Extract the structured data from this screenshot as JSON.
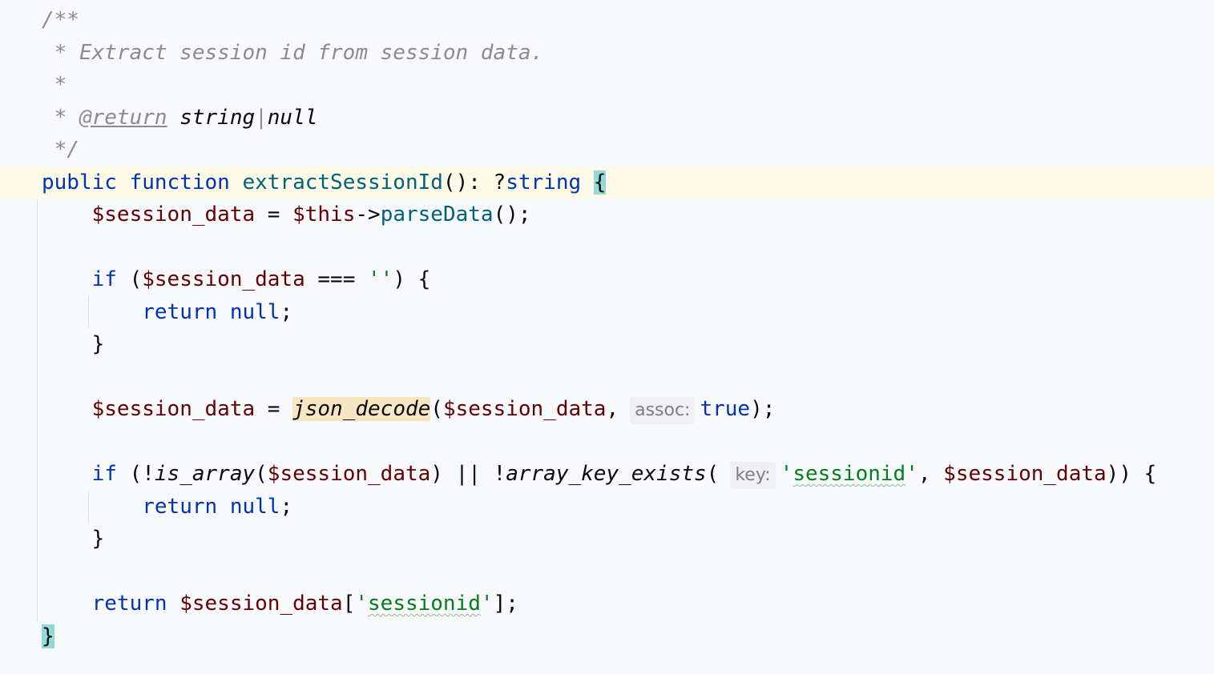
{
  "editor": {
    "language": "PHP",
    "lines": [
      {
        "tokens": [
          {
            "t": "/**",
            "c": "cm"
          }
        ]
      },
      {
        "tokens": [
          {
            "t": " * Extract session id from session data.",
            "c": "cm"
          }
        ]
      },
      {
        "tokens": [
          {
            "t": " *",
            "c": "cm"
          }
        ]
      },
      {
        "tokens": [
          {
            "t": " * ",
            "c": "cm"
          },
          {
            "t": "@return",
            "c": "tag"
          },
          {
            "t": " string",
            "c": "type"
          },
          {
            "t": "|",
            "c": "cm"
          },
          {
            "t": "null",
            "c": "type"
          }
        ]
      },
      {
        "tokens": [
          {
            "t": " */",
            "c": "cm"
          }
        ]
      },
      {
        "current": true,
        "tokens": [
          {
            "t": "public",
            "c": "kw"
          },
          {
            "t": " ",
            "c": "op"
          },
          {
            "t": "function",
            "c": "kw"
          },
          {
            "t": " ",
            "c": "op"
          },
          {
            "t": "extractSessionId",
            "c": "fn"
          },
          {
            "t": "(): ?",
            "c": "op"
          },
          {
            "t": "string",
            "c": "kw"
          },
          {
            "t": " ",
            "c": "op"
          },
          {
            "t": "{",
            "c": "op brace-hl"
          }
        ]
      },
      {
        "tokens": [
          {
            "t": "    ",
            "c": "op"
          },
          {
            "t": "$session_data",
            "c": "var2"
          },
          {
            "t": " = ",
            "c": "op"
          },
          {
            "t": "$this",
            "c": "var2"
          },
          {
            "t": "->",
            "c": "op"
          },
          {
            "t": "parseData",
            "c": "fn"
          },
          {
            "t": "();",
            "c": "op"
          }
        ]
      },
      {
        "tokens": []
      },
      {
        "tokens": [
          {
            "t": "    ",
            "c": "op"
          },
          {
            "t": "if",
            "c": "kw"
          },
          {
            "t": " (",
            "c": "op"
          },
          {
            "t": "$session_data",
            "c": "var2"
          },
          {
            "t": " === ",
            "c": "op"
          },
          {
            "t": "''",
            "c": "str"
          },
          {
            "t": ") {",
            "c": "op"
          }
        ]
      },
      {
        "tokens": [
          {
            "t": "        ",
            "c": "op"
          },
          {
            "t": "return",
            "c": "kw"
          },
          {
            "t": " ",
            "c": "op"
          },
          {
            "t": "null",
            "c": "kw"
          },
          {
            "t": ";",
            "c": "op"
          }
        ]
      },
      {
        "tokens": [
          {
            "t": "    }",
            "c": "op"
          }
        ]
      },
      {
        "tokens": []
      },
      {
        "tokens": [
          {
            "t": "    ",
            "c": "op"
          },
          {
            "t": "$session_data",
            "c": "var2"
          },
          {
            "t": " = ",
            "c": "op"
          },
          {
            "t": "json_decode",
            "c": "builtin word-hl"
          },
          {
            "t": "(",
            "c": "op"
          },
          {
            "t": "$session_data",
            "c": "var2"
          },
          {
            "t": ",",
            "c": "op"
          },
          {
            "t": "assoc:",
            "c": "hint"
          },
          {
            "t": "true",
            "c": "kw"
          },
          {
            "t": ");",
            "c": "op"
          }
        ]
      },
      {
        "tokens": []
      },
      {
        "tokens": [
          {
            "t": "    ",
            "c": "op"
          },
          {
            "t": "if",
            "c": "kw"
          },
          {
            "t": " (!",
            "c": "op"
          },
          {
            "t": "is_array",
            "c": "builtin"
          },
          {
            "t": "(",
            "c": "op"
          },
          {
            "t": "$session_data",
            "c": "var2"
          },
          {
            "t": ") || !",
            "c": "op"
          },
          {
            "t": "array_key_exists",
            "c": "builtin"
          },
          {
            "t": "(",
            "c": "op"
          },
          {
            "t": "key:",
            "c": "hint"
          },
          {
            "t": "'",
            "c": "str"
          },
          {
            "t": "sessionid",
            "c": "str squiggle"
          },
          {
            "t": "'",
            "c": "str"
          },
          {
            "t": ", ",
            "c": "op"
          },
          {
            "t": "$session_data",
            "c": "var2"
          },
          {
            "t": ")) {",
            "c": "op"
          }
        ]
      },
      {
        "tokens": [
          {
            "t": "        ",
            "c": "op"
          },
          {
            "t": "return",
            "c": "kw"
          },
          {
            "t": " ",
            "c": "op"
          },
          {
            "t": "null",
            "c": "kw"
          },
          {
            "t": ";",
            "c": "op"
          }
        ]
      },
      {
        "tokens": [
          {
            "t": "    }",
            "c": "op"
          }
        ]
      },
      {
        "tokens": []
      },
      {
        "tokens": [
          {
            "t": "    ",
            "c": "op"
          },
          {
            "t": "return",
            "c": "kw"
          },
          {
            "t": " ",
            "c": "op"
          },
          {
            "t": "$session_data",
            "c": "var2"
          },
          {
            "t": "[",
            "c": "op"
          },
          {
            "t": "'",
            "c": "str"
          },
          {
            "t": "sessionid",
            "c": "str squiggle"
          },
          {
            "t": "'",
            "c": "str"
          },
          {
            "t": "];",
            "c": "op"
          }
        ]
      },
      {
        "tokens": [
          {
            "t": "}",
            "c": "op brace-hl"
          }
        ]
      }
    ]
  }
}
